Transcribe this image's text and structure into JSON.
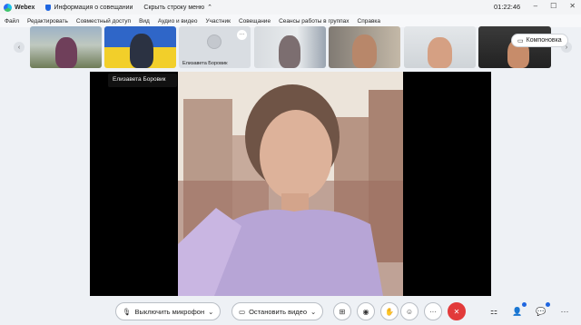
{
  "titlebar": {
    "app_name": "Webex",
    "meeting_info": "Информация о совещании",
    "hide_menu": "Скрыть строку меню",
    "time": "01:22:46"
  },
  "menu": [
    "Файл",
    "Редактировать",
    "Совместный доступ",
    "Вид",
    "Аудио и видео",
    "Участник",
    "Совещание",
    "Сеансы работы в группах",
    "Справка"
  ],
  "filmstrip": {
    "placeholder_name": "Елизавета Боровик",
    "layout_label": "Компоновка"
  },
  "tooltip": "Елизавета Боровик",
  "controls": {
    "mute_label": "Выключить микрофон",
    "video_label": "Остановить видео"
  },
  "colors": {
    "end_call": "#e23a3a",
    "accent": "#1f66e0"
  }
}
